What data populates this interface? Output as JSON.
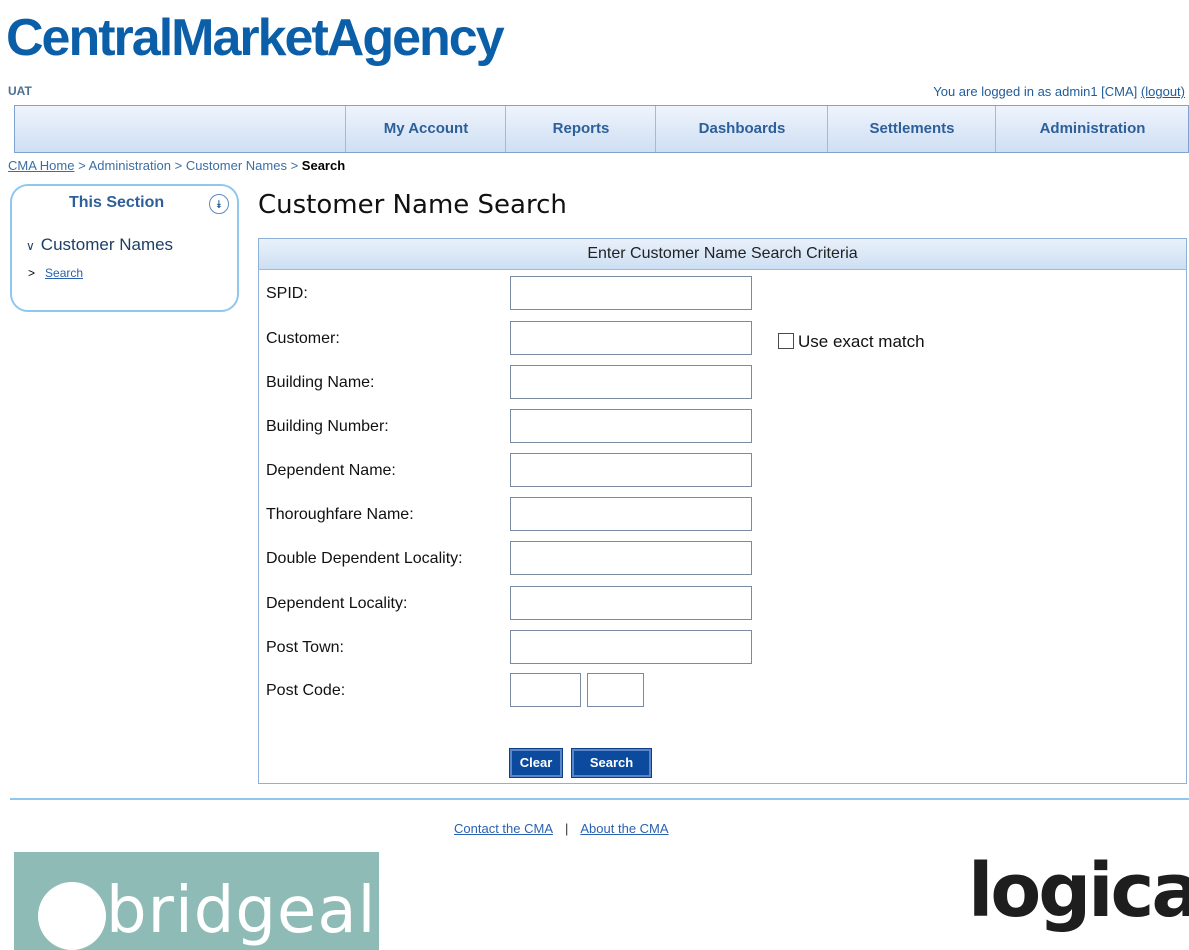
{
  "brand": {
    "logo_text": "CentralMarketAgency",
    "env_label": "UAT"
  },
  "user": {
    "logged_in_text": "You are logged in as admin1 [CMA]",
    "logout_label": "(logout)"
  },
  "nav": {
    "items": [
      {
        "label": "My Account"
      },
      {
        "label": "Reports"
      },
      {
        "label": "Dashboards"
      },
      {
        "label": "Settlements"
      },
      {
        "label": "Administration"
      }
    ]
  },
  "breadcrumb": {
    "items": [
      "CMA Home",
      "Administration",
      "Customer Names"
    ],
    "separator": ">",
    "current": "Search"
  },
  "sidebar": {
    "title": "This Section",
    "collapse_icon": "double-chevron-down-icon",
    "section_label": "Customer Names",
    "sub_label": "Search"
  },
  "page": {
    "title": "Customer Name Search"
  },
  "form": {
    "header": "Enter Customer Name Search Criteria",
    "fields": {
      "spid": {
        "label": "SPID:",
        "value": ""
      },
      "customer": {
        "label": "Customer:",
        "value": ""
      },
      "building_name": {
        "label": "Building Name:",
        "value": ""
      },
      "building_number": {
        "label": "Building Number:",
        "value": ""
      },
      "dependent_name": {
        "label": "Dependent Name:",
        "value": ""
      },
      "thoroughfare_name": {
        "label": "Thoroughfare Name:",
        "value": ""
      },
      "double_dependent_locality": {
        "label": "Double Dependent Locality:",
        "value": ""
      },
      "dependent_locality": {
        "label": "Dependent Locality:",
        "value": ""
      },
      "post_town": {
        "label": "Post Town:",
        "value": ""
      },
      "post_code": {
        "label": "Post Code:",
        "value_part1": "",
        "value_part2": ""
      }
    },
    "exact_match": {
      "label": "Use exact match",
      "checked": false
    },
    "buttons": {
      "clear": "Clear",
      "search": "Search"
    }
  },
  "footer": {
    "contact": "Contact the CMA",
    "about": "About the CMA",
    "separator": "|",
    "partner_logo_left": "bridgeall",
    "partner_logo_right": "logica"
  },
  "colors": {
    "brand_blue": "#0b5ea8",
    "button_blue": "#0c4a9e",
    "accent_cyan": "#8fc8ec"
  }
}
